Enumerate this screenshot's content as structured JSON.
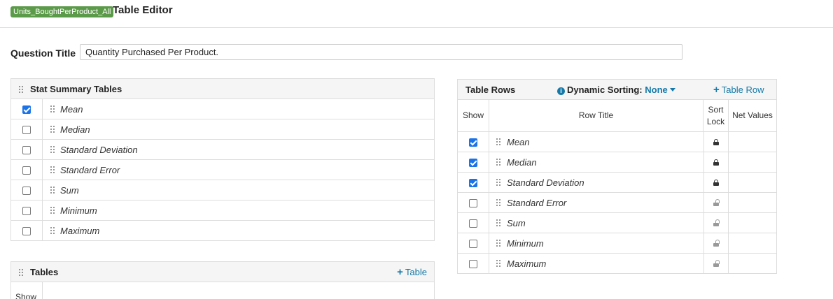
{
  "header": {
    "badge": "Units_BoughtPerProduct_All",
    "title": "Table Editor"
  },
  "question": {
    "label": "Question Title",
    "value": "Quantity Purchased Per Product."
  },
  "stat_panel": {
    "title": "Stat Summary Tables",
    "items": [
      {
        "label": "Mean",
        "checked": true
      },
      {
        "label": "Median",
        "checked": false
      },
      {
        "label": "Standard Deviation",
        "checked": false
      },
      {
        "label": "Standard Error",
        "checked": false
      },
      {
        "label": "Sum",
        "checked": false
      },
      {
        "label": "Minimum",
        "checked": false
      },
      {
        "label": "Maximum",
        "checked": false
      }
    ]
  },
  "tables_panel": {
    "title": "Tables",
    "add_label": "Table",
    "col_show": "Show"
  },
  "rows_panel": {
    "title": "Table Rows",
    "sorting_label": "Dynamic Sorting:",
    "sorting_value": "None",
    "add_label": "Table Row",
    "columns": {
      "show": "Show",
      "row_title": "Row Title",
      "sort_lock_1": "Sort",
      "sort_lock_2": "Lock",
      "net_values": "Net Values"
    },
    "rows": [
      {
        "label": "Mean",
        "checked": true,
        "locked": true
      },
      {
        "label": "Median",
        "checked": true,
        "locked": true
      },
      {
        "label": "Standard Deviation",
        "checked": true,
        "locked": true
      },
      {
        "label": "Standard Error",
        "checked": false,
        "locked": false
      },
      {
        "label": "Sum",
        "checked": false,
        "locked": false
      },
      {
        "label": "Minimum",
        "checked": false,
        "locked": false
      },
      {
        "label": "Maximum",
        "checked": false,
        "locked": false
      }
    ]
  },
  "colors": {
    "badge": "#5b9a48",
    "link": "#1479a8",
    "checkbox": "#1a73e8"
  }
}
